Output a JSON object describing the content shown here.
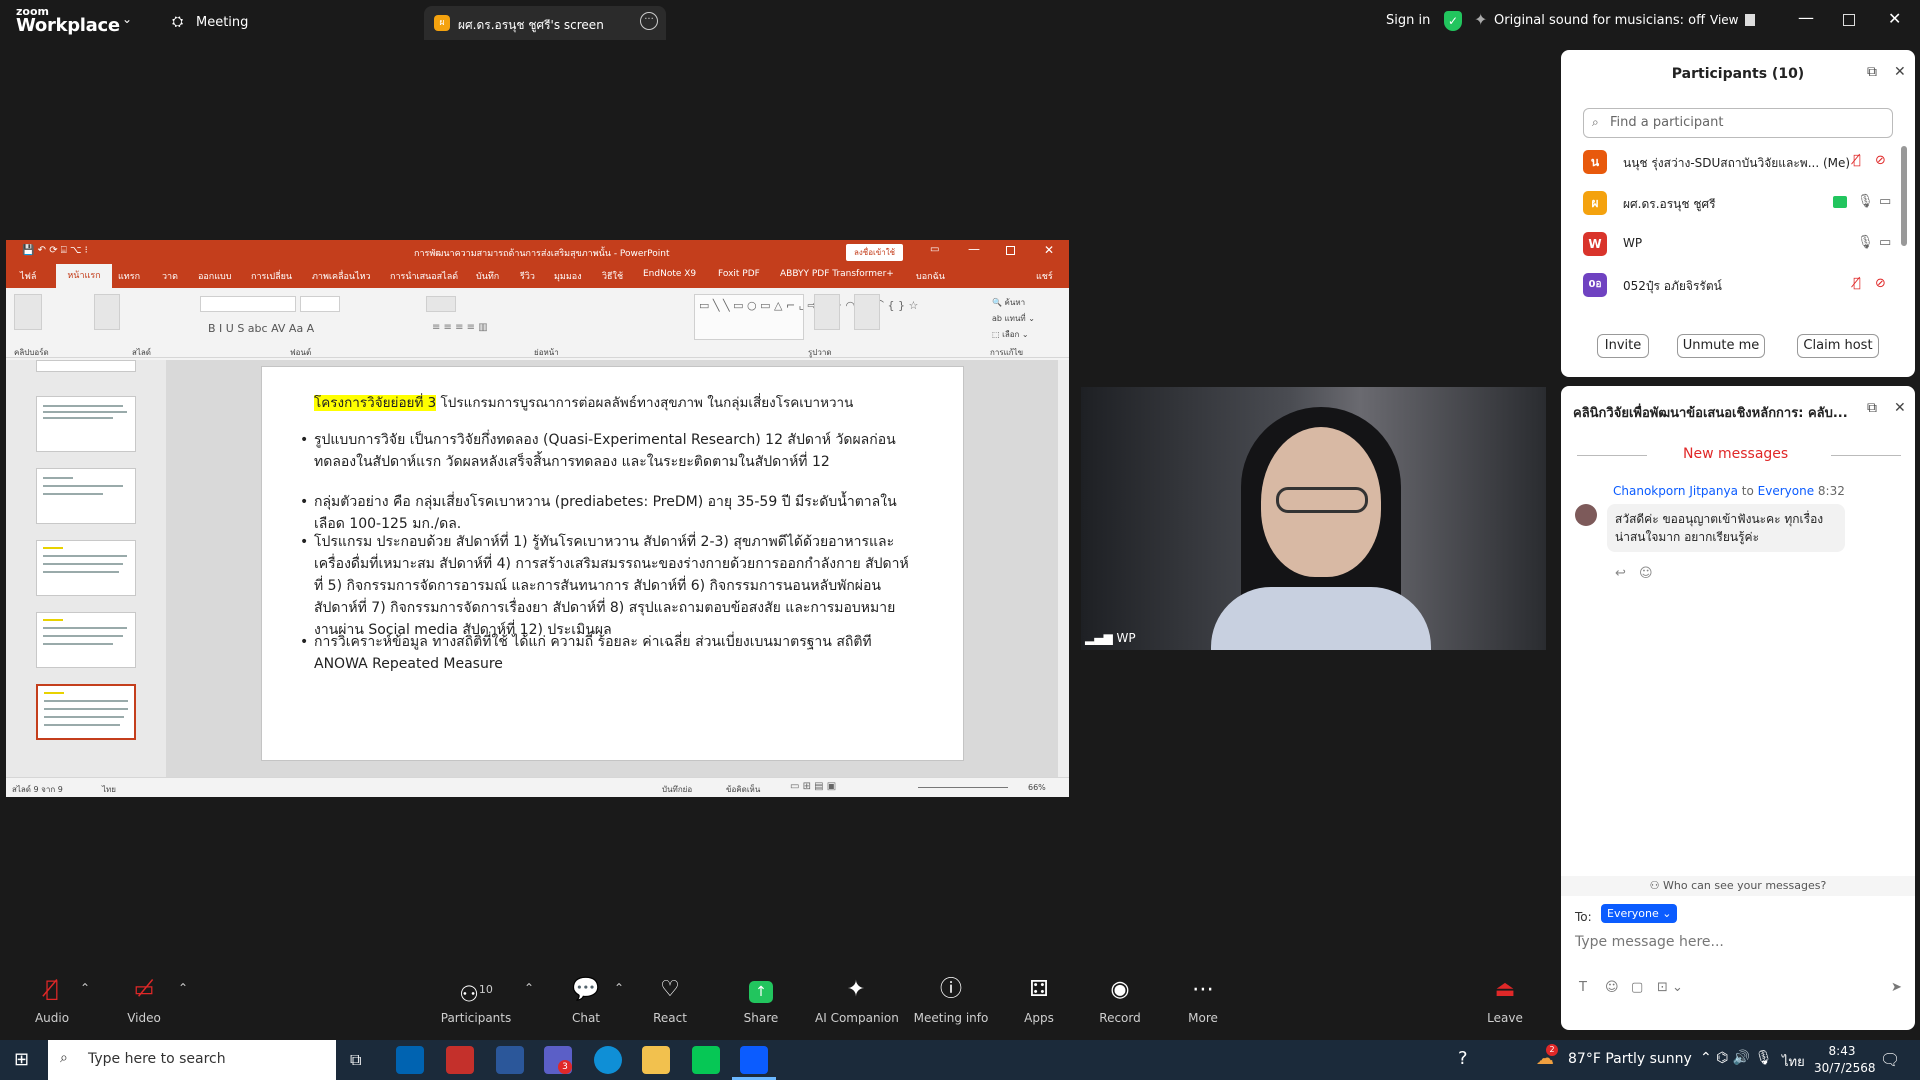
{
  "app": {
    "brand_top": "zoom",
    "brand_bottom": "Workplace",
    "meeting_label": "Meeting",
    "share_tab_label": "ผศ.ดร.อรนุช ชูศรี's screen",
    "share_tab_initial": "ผ",
    "sign_in": "Sign in",
    "original_sound": "Original sound for musicians: off",
    "view_label": "View"
  },
  "ppt": {
    "window_title": "การพัฒนาความสามารถด้านการส่งเสริมสุขภาพนั้น - PowerPoint",
    "signin_btn": "ลงชื่อเข้าใช้",
    "tabs": [
      "ไฟล์",
      "หน้าแรก",
      "แทรก",
      "วาด",
      "ออกแบบ",
      "การเปลี่ยน",
      "ภาพเคลื่อนไหว",
      "การนำเสนอสไลด์",
      "บันทึก",
      "รีวิว",
      "มุมมอง",
      "วิธีใช้",
      "EndNote X9",
      "Foxit PDF",
      "ABBYY PDF Transformer+",
      "บอกฉัน",
      "แชร์"
    ],
    "groups": [
      "คลิปบอร์ด",
      "สไลด์",
      "ฟอนต์",
      "ย่อหน้า",
      "รูปวาด",
      "การแก้ไข"
    ],
    "status_slide": "สไลด์ 9 จาก 9",
    "status_lang": "ไทย",
    "status_notes": "บันทึกย่อ",
    "status_comments": "ข้อคิดเห็น",
    "zoom": "66%",
    "slide": {
      "title_highlight": "โครงการวิจัยย่อยที่ 3",
      "title_rest": " โปรแกรมการบูรณาการต่อผลลัพธ์ทางสุขภาพ ในกลุ่มเสี่ยงโรคเบาหวาน",
      "bullets": [
        "รูปแบบการวิจัย  เป็นการวิจัยกึ่งทดลอง (Quasi-Experimental Research) 12 สัปดาห์ วัดผลก่อนทดลองในสัปดาห์แรก วัดผลหลังเสร็จสิ้นการทดลอง และในระยะติดตามในสัปดาห์ที่ 12",
        "กลุ่มตัวอย่าง คือ กลุ่มเสี่ยงโรคเบาหวาน (prediabetes: PreDM) อายุ 35-59 ปี มีระดับน้ำตาลในเลือด 100-125 มก./ดล.",
        "โปรแกรม ประกอบด้วย สัปดาห์ที่ 1)   รู้ทันโรคเบาหวาน สัปดาห์ที่ 2-3) สุขภาพดีได้ด้วยอาหารและเครื่องดื่มที่เหมาะสม สัปดาห์ที่ 4)   การสร้างเสริมสมรรถนะของร่างกายด้วยการออกกำลังกาย สัปดาห์ที่ 5)   กิจกรรมการจัดการอารมณ์ และการสันทนาการ สัปดาห์ที่ 6) กิจกรรมการนอนหลับพักผ่อน สัปดาห์ที่ 7)   กิจกรรมการจัดการเรื่องยา สัปดาห์ที่ 8)    สรุปและถามตอบข้อสงสัย และการมอบหมายงานผ่าน Social media สัปดาห์ที่ 12) ประเมินผล",
        "การวิเคราะห์ข้อมูล ทางสถิติที่ใช้ ได้แก่ ความถี่ ร้อยละ ค่าเฉลี่ย ส่วนเบี่ยงเบนมาตรฐาน สถิติที ANOWA Repeated Measure"
      ]
    }
  },
  "video": {
    "label": "WP"
  },
  "participants": {
    "title": "Participants (10)",
    "search_placeholder": "Find a participant",
    "list": [
      {
        "initial": "น",
        "name": "นนุช รุ่งสว่าง-SDUสถาบันวิจัยและพ... (Me)",
        "color": "#e8590c"
      },
      {
        "initial": "ผ",
        "name": "ผศ.ดร.อรนุช ชูศรี",
        "color": "#f4a20e"
      },
      {
        "initial": "W",
        "name": "WP",
        "color": "#d9342b"
      },
      {
        "initial": "0อ",
        "name": "052ปุ๋ร  อภัยจิรรัตน์",
        "color": "#6f42c1"
      }
    ],
    "invite": "Invite",
    "unmute": "Unmute me",
    "claim": "Claim host"
  },
  "chat": {
    "title": "คลินิกวิจัยเพื่อพัฒนาข้อเสนอเชิงหลักการ: คลับ...",
    "new_messages": "New messages",
    "sender": "Chanokporn Jitpanya",
    "to_word": "to",
    "recipient": "Everyone",
    "time": "8:32",
    "message": "สวัสดีค่ะ ขออนุญาตเข้าฟังนะคะ ทุกเรื่องน่าสนใจมาก อยากเรียนรู้ค่ะ",
    "who_can_see": "Who can see your messages?",
    "to_label": "To:",
    "to_value": "Everyone",
    "input_placeholder": "Type message here..."
  },
  "toolbar": {
    "audio": "Audio",
    "video": "Video",
    "participants": "Participants",
    "participants_count": "10",
    "chat": "Chat",
    "react": "React",
    "share": "Share",
    "ai": "AI Companion",
    "info": "Meeting info",
    "apps": "Apps",
    "record": "Record",
    "more": "More",
    "leave": "Leave"
  },
  "taskbar": {
    "search_placeholder": "Type here to search",
    "weather": "87°F  Partly sunny",
    "lang": "ไทย",
    "time": "8:43",
    "date": "30/7/2568",
    "teams_badge": "3",
    "weather_badge": "2"
  },
  "colors": {
    "ppt_red": "#c43e1c",
    "zoom_blue": "#0b5cff",
    "share_green": "#22c55e",
    "leave_red": "#e02828"
  }
}
